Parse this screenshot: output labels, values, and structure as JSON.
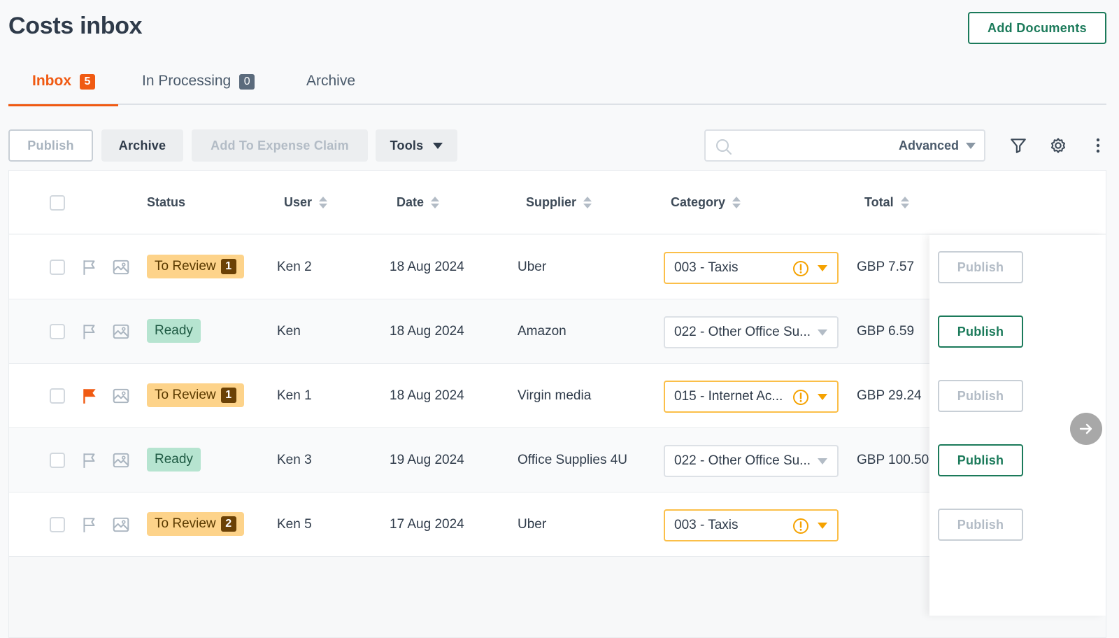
{
  "page": {
    "title": "Costs inbox",
    "add_documents_label": "Add Documents"
  },
  "tabs": [
    {
      "label": "Inbox",
      "count": "5"
    },
    {
      "label": "In Processing",
      "count": "0"
    },
    {
      "label": "Archive"
    }
  ],
  "toolbar": {
    "publish_label": "Publish",
    "archive_label": "Archive",
    "add_to_expense_claim_label": "Add To Expense Claim",
    "tools_label": "Tools",
    "search_placeholder": "",
    "advanced_label": "Advanced"
  },
  "table": {
    "columns": {
      "status": "Status",
      "user": "User",
      "date": "Date",
      "supplier": "Supplier",
      "category": "Category",
      "total": "Total"
    },
    "rows": [
      {
        "flagged": false,
        "status": "To Review",
        "status_count": "1",
        "user": "Ken 2",
        "date": "18 Aug 2024",
        "supplier": "Uber",
        "category": "003 - Taxis",
        "category_warning": true,
        "total": "GBP 7.57",
        "publish_label": "Publish",
        "publish_enabled": false
      },
      {
        "flagged": false,
        "status": "Ready",
        "status_count": "",
        "user": "Ken",
        "date": "18 Aug 2024",
        "supplier": "Amazon",
        "category": "022 - Other Office Su...",
        "category_warning": false,
        "total": "GBP 6.59",
        "publish_label": "Publish",
        "publish_enabled": true
      },
      {
        "flagged": true,
        "status": "To Review",
        "status_count": "1",
        "user": "Ken 1",
        "date": "18 Aug 2024",
        "supplier": "Virgin media",
        "category": "015 - Internet Ac...",
        "category_warning": true,
        "total": "GBP 29.24",
        "publish_label": "Publish",
        "publish_enabled": false
      },
      {
        "flagged": false,
        "status": "Ready",
        "status_count": "",
        "user": "Ken 3",
        "date": "19 Aug 2024",
        "supplier": "Office Supplies 4U",
        "category": "022 - Other Office Su...",
        "category_warning": false,
        "total": "GBP 100.50",
        "publish_label": "Publish",
        "publish_enabled": true
      },
      {
        "flagged": false,
        "status": "To Review",
        "status_count": "2",
        "user": "Ken 5",
        "date": "17 Aug 2024",
        "supplier": "Uber",
        "category": "003 - Taxis",
        "category_warning": true,
        "total": "",
        "publish_label": "Publish",
        "publish_enabled": false
      }
    ]
  },
  "colors": {
    "accent": "#f05a12",
    "primary": "#1b7a5a",
    "warning": "#f5a200",
    "review_bg": "#fdd38a",
    "ready_bg": "#b6e4d0",
    "text": "#2f3b4a"
  },
  "icons": [
    "search-icon",
    "filter-icon",
    "gear-icon",
    "more-vertical-icon",
    "flag-icon",
    "image-icon",
    "warning-circle-icon",
    "chevron-down-icon",
    "arrow-right-icon"
  ]
}
